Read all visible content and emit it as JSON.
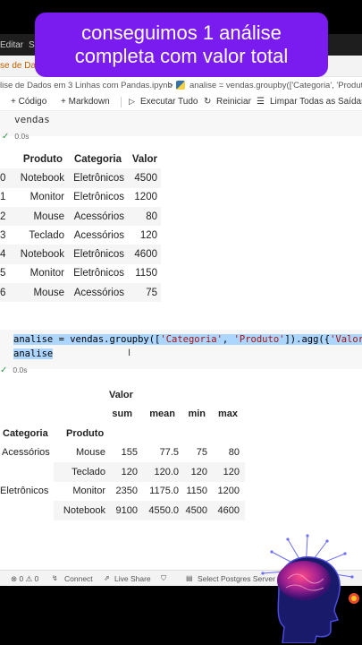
{
  "caption": {
    "line1": "conseguimos 1 análise",
    "line2": "completa com valor total"
  },
  "menubar": {
    "item1": "Editar",
    "item2": "Se"
  },
  "tab": {
    "label": "se de Dados"
  },
  "breadcrumb": {
    "path": "lise de Dados em 3 Linhas com Pandas.ipynb",
    "separator": ">",
    "symbol": "analise = vendas.groupby(['Categoria', 'Produto"
  },
  "toolbar": {
    "code_label": "+ Código",
    "markdown_label": "+ Markdown",
    "run_all_label": "Executar Tudo",
    "restart_label": "Reiniciar",
    "clear_label": "Limpar Todas as Saídas"
  },
  "cell1": {
    "code": "vendas",
    "time": "0.0s"
  },
  "vendas_table": {
    "headers": [
      "",
      "Produto",
      "Categoria",
      "Valor"
    ],
    "rows": [
      [
        "0",
        "Notebook",
        "Eletrônicos",
        "4500"
      ],
      [
        "1",
        "Monitor",
        "Eletrônicos",
        "1200"
      ],
      [
        "2",
        "Mouse",
        "Acessórios",
        "80"
      ],
      [
        "3",
        "Teclado",
        "Acessórios",
        "120"
      ],
      [
        "4",
        "Notebook",
        "Eletrônicos",
        "4600"
      ],
      [
        "5",
        "Monitor",
        "Eletrônicos",
        "1150"
      ],
      [
        "6",
        "Mouse",
        "Acessórios",
        "75"
      ]
    ]
  },
  "cell2": {
    "line1_var": "analise",
    "line1_eq": " = vendas.groupby([",
    "line1_str1": "'Categoria'",
    "line1_comma": ", ",
    "line1_str2": "'Produto'",
    "line1_tail": "]).agg({",
    "line1_str3": "'Valor",
    "line2": "analise",
    "time": "0.0s"
  },
  "agg_table": {
    "top_header": "Valor",
    "stat_headers": [
      "sum",
      "mean",
      "min",
      "max"
    ],
    "index_headers": [
      "Categoria",
      "Produto"
    ],
    "rows": [
      {
        "categoria": "Acessórios",
        "produto": "Mouse",
        "values": [
          "155",
          "77.5",
          "75",
          "80"
        ]
      },
      {
        "categoria": "",
        "produto": "Teclado",
        "values": [
          "120",
          "120.0",
          "120",
          "120"
        ]
      },
      {
        "categoria": "Eletrônicos",
        "produto": "Monitor",
        "values": [
          "2350",
          "1175.0",
          "1150",
          "1200"
        ]
      },
      {
        "categoria": "",
        "produto": "Notebook",
        "values": [
          "9100",
          "4550.0",
          "4500",
          "4600"
        ]
      }
    ]
  },
  "status_bar": {
    "errors": "⊗ 0 ⚠ 0",
    "connect": "Connect",
    "live_share": "Live Share",
    "postgres": "Select Postgres Server"
  },
  "colors": {
    "caption_bg": "#7a1cf0",
    "tab_label": "#c06000",
    "check": "#2e9b45"
  }
}
